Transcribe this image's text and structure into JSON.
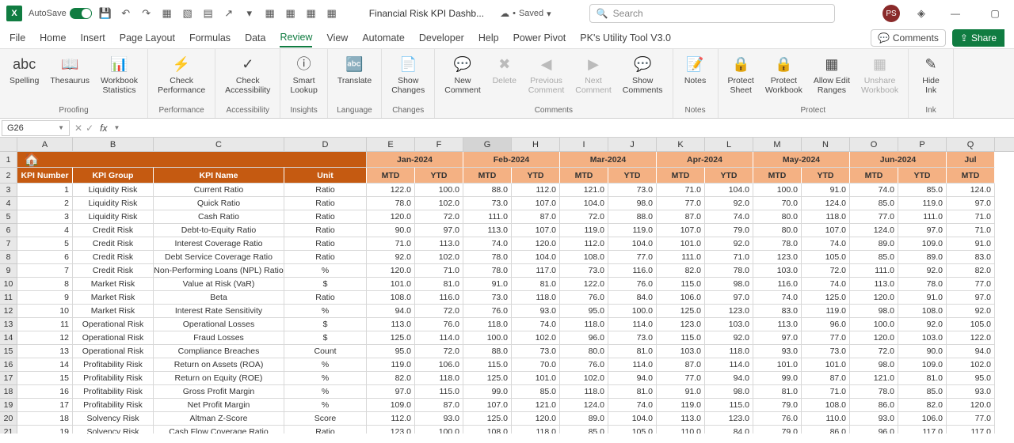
{
  "titlebar": {
    "autosave": "AutoSave",
    "doc_title": "Financial Risk KPI Dashb...",
    "saved": "Saved",
    "search_placeholder": "Search",
    "avatar": "PS"
  },
  "tabs": {
    "file": "File",
    "home": "Home",
    "insert": "Insert",
    "pagelayout": "Page Layout",
    "formulas": "Formulas",
    "data": "Data",
    "review": "Review",
    "view": "View",
    "automate": "Automate",
    "developer": "Developer",
    "help": "Help",
    "powerpivot": "Power Pivot",
    "pk": "PK's Utility Tool V3.0",
    "comments": "Comments",
    "share": "Share"
  },
  "ribbon": {
    "proofing": "Proofing",
    "performance": "Performance",
    "accessibility": "Accessibility",
    "insights": "Insights",
    "language": "Language",
    "changes": "Changes",
    "comments": "Comments",
    "notes": "Notes",
    "protect": "Protect",
    "ink": "Ink",
    "spelling": "Spelling",
    "thesaurus": "Thesaurus",
    "wbstats": "Workbook\nStatistics",
    "checkperf": "Check\nPerformance",
    "checkacc": "Check\nAccessibility",
    "smartlookup": "Smart\nLookup",
    "translate": "Translate",
    "showchanges": "Show\nChanges",
    "newcomment": "New\nComment",
    "delete": "Delete",
    "prevcomment": "Previous\nComment",
    "nextcomment": "Next\nComment",
    "showcomments": "Show\nComments",
    "notes_btn": "Notes",
    "protectsheet": "Protect\nSheet",
    "protectwb": "Protect\nWorkbook",
    "alloweditranges": "Allow Edit\nRanges",
    "unsharewb": "Unshare\nWorkbook",
    "hideink": "Hide\nInk"
  },
  "namebox": "G26",
  "cols": [
    "A",
    "B",
    "C",
    "D",
    "E",
    "F",
    "G",
    "H",
    "I",
    "J",
    "K",
    "L",
    "M",
    "N",
    "O",
    "P",
    "Q"
  ],
  "months": [
    "Jan-2024",
    "Feb-2024",
    "Mar-2024",
    "Apr-2024",
    "May-2024",
    "Jun-2024",
    "Jul"
  ],
  "sub": [
    "MTD",
    "YTD"
  ],
  "hdr": {
    "num": "KPI Number",
    "group": "KPI Group",
    "name": "KPI Name",
    "unit": "Unit"
  },
  "rows": [
    {
      "n": "1",
      "g": "Liquidity Risk",
      "name": "Current Ratio",
      "u": "Ratio",
      "v": [
        "122.0",
        "100.0",
        "88.0",
        "112.0",
        "121.0",
        "73.0",
        "71.0",
        "104.0",
        "100.0",
        "91.0",
        "74.0",
        "85.0",
        "124.0"
      ]
    },
    {
      "n": "2",
      "g": "Liquidity Risk",
      "name": "Quick Ratio",
      "u": "Ratio",
      "v": [
        "78.0",
        "102.0",
        "73.0",
        "107.0",
        "104.0",
        "98.0",
        "77.0",
        "92.0",
        "70.0",
        "124.0",
        "85.0",
        "119.0",
        "97.0"
      ]
    },
    {
      "n": "3",
      "g": "Liquidity Risk",
      "name": "Cash Ratio",
      "u": "Ratio",
      "v": [
        "120.0",
        "72.0",
        "111.0",
        "87.0",
        "72.0",
        "88.0",
        "87.0",
        "74.0",
        "80.0",
        "118.0",
        "77.0",
        "111.0",
        "71.0"
      ]
    },
    {
      "n": "4",
      "g": "Credit Risk",
      "name": "Debt-to-Equity Ratio",
      "u": "Ratio",
      "v": [
        "90.0",
        "97.0",
        "113.0",
        "107.0",
        "119.0",
        "119.0",
        "107.0",
        "79.0",
        "80.0",
        "107.0",
        "124.0",
        "97.0",
        "71.0"
      ]
    },
    {
      "n": "5",
      "g": "Credit Risk",
      "name": "Interest Coverage Ratio",
      "u": "Ratio",
      "v": [
        "71.0",
        "113.0",
        "74.0",
        "120.0",
        "112.0",
        "104.0",
        "101.0",
        "92.0",
        "78.0",
        "74.0",
        "89.0",
        "109.0",
        "91.0"
      ]
    },
    {
      "n": "6",
      "g": "Credit Risk",
      "name": "Debt Service Coverage Ratio",
      "u": "Ratio",
      "v": [
        "92.0",
        "102.0",
        "78.0",
        "104.0",
        "108.0",
        "77.0",
        "111.0",
        "71.0",
        "123.0",
        "105.0",
        "85.0",
        "89.0",
        "83.0"
      ]
    },
    {
      "n": "7",
      "g": "Credit Risk",
      "name": "Non-Performing Loans (NPL) Ratio",
      "u": "%",
      "v": [
        "120.0",
        "71.0",
        "78.0",
        "117.0",
        "73.0",
        "116.0",
        "82.0",
        "78.0",
        "103.0",
        "72.0",
        "111.0",
        "92.0",
        "82.0"
      ]
    },
    {
      "n": "8",
      "g": "Market Risk",
      "name": "Value at Risk (VaR)",
      "u": "$",
      "v": [
        "101.0",
        "81.0",
        "91.0",
        "81.0",
        "122.0",
        "76.0",
        "115.0",
        "98.0",
        "116.0",
        "74.0",
        "113.0",
        "78.0",
        "77.0"
      ]
    },
    {
      "n": "9",
      "g": "Market Risk",
      "name": "Beta",
      "u": "Ratio",
      "v": [
        "108.0",
        "116.0",
        "73.0",
        "118.0",
        "76.0",
        "84.0",
        "106.0",
        "97.0",
        "74.0",
        "125.0",
        "120.0",
        "91.0",
        "97.0"
      ]
    },
    {
      "n": "10",
      "g": "Market Risk",
      "name": "Interest Rate Sensitivity",
      "u": "%",
      "v": [
        "94.0",
        "72.0",
        "76.0",
        "93.0",
        "95.0",
        "100.0",
        "125.0",
        "123.0",
        "83.0",
        "119.0",
        "98.0",
        "108.0",
        "92.0"
      ]
    },
    {
      "n": "11",
      "g": "Operational Risk",
      "name": "Operational Losses",
      "u": "$",
      "v": [
        "113.0",
        "76.0",
        "118.0",
        "74.0",
        "118.0",
        "114.0",
        "123.0",
        "103.0",
        "113.0",
        "96.0",
        "100.0",
        "92.0",
        "105.0"
      ]
    },
    {
      "n": "12",
      "g": "Operational Risk",
      "name": "Fraud Losses",
      "u": "$",
      "v": [
        "125.0",
        "114.0",
        "100.0",
        "102.0",
        "96.0",
        "73.0",
        "115.0",
        "92.0",
        "97.0",
        "77.0",
        "120.0",
        "103.0",
        "122.0"
      ]
    },
    {
      "n": "13",
      "g": "Operational Risk",
      "name": "Compliance Breaches",
      "u": "Count",
      "v": [
        "95.0",
        "72.0",
        "88.0",
        "73.0",
        "80.0",
        "81.0",
        "103.0",
        "118.0",
        "93.0",
        "73.0",
        "72.0",
        "90.0",
        "94.0"
      ]
    },
    {
      "n": "14",
      "g": "Profitability Risk",
      "name": "Return on Assets (ROA)",
      "u": "%",
      "v": [
        "119.0",
        "106.0",
        "115.0",
        "70.0",
        "76.0",
        "114.0",
        "87.0",
        "114.0",
        "101.0",
        "101.0",
        "98.0",
        "109.0",
        "102.0"
      ]
    },
    {
      "n": "15",
      "g": "Profitability Risk",
      "name": "Return on Equity (ROE)",
      "u": "%",
      "v": [
        "82.0",
        "118.0",
        "125.0",
        "101.0",
        "102.0",
        "94.0",
        "77.0",
        "94.0",
        "99.0",
        "87.0",
        "121.0",
        "81.0",
        "95.0"
      ]
    },
    {
      "n": "16",
      "g": "Profitability Risk",
      "name": "Gross Profit Margin",
      "u": "%",
      "v": [
        "97.0",
        "115.0",
        "99.0",
        "85.0",
        "118.0",
        "81.0",
        "91.0",
        "98.0",
        "81.0",
        "71.0",
        "78.0",
        "85.0",
        "93.0"
      ]
    },
    {
      "n": "17",
      "g": "Profitability Risk",
      "name": "Net Profit Margin",
      "u": "%",
      "v": [
        "109.0",
        "87.0",
        "107.0",
        "121.0",
        "124.0",
        "74.0",
        "119.0",
        "115.0",
        "79.0",
        "108.0",
        "86.0",
        "82.0",
        "120.0"
      ]
    },
    {
      "n": "18",
      "g": "Solvency Risk",
      "name": "Altman Z-Score",
      "u": "Score",
      "v": [
        "112.0",
        "93.0",
        "125.0",
        "120.0",
        "89.0",
        "104.0",
        "113.0",
        "123.0",
        "76.0",
        "110.0",
        "93.0",
        "106.0",
        "77.0"
      ]
    },
    {
      "n": "19",
      "g": "Solvency Risk",
      "name": "Cash Flow Coverage Ratio",
      "u": "Ratio",
      "v": [
        "123.0",
        "100.0",
        "108.0",
        "118.0",
        "85.0",
        "105.0",
        "110.0",
        "84.0",
        "79.0",
        "86.0",
        "96.0",
        "117.0",
        "117.0"
      ]
    }
  ]
}
